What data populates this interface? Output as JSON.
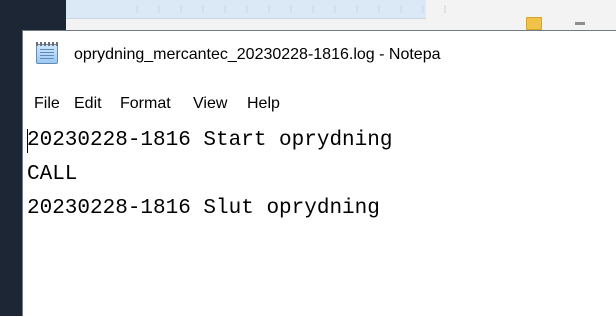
{
  "window": {
    "title": "oprydning_mercantec_20230228-1816.log - Notepa",
    "app_icon": "notepad-icon"
  },
  "menu": {
    "file": "File",
    "edit": "Edit",
    "format": "Format",
    "view": "View",
    "help": "Help"
  },
  "editor": {
    "lines": [
      "20230228-1816 Start oprydning",
      "CALL",
      "20230228-1816 Slut oprydning"
    ]
  },
  "background_icons": {
    "yellow_icon": "folder-icon"
  },
  "colors": {
    "desktop_dark": "#1d2634",
    "window_border": "#6e7a8a",
    "text": "#000000"
  }
}
